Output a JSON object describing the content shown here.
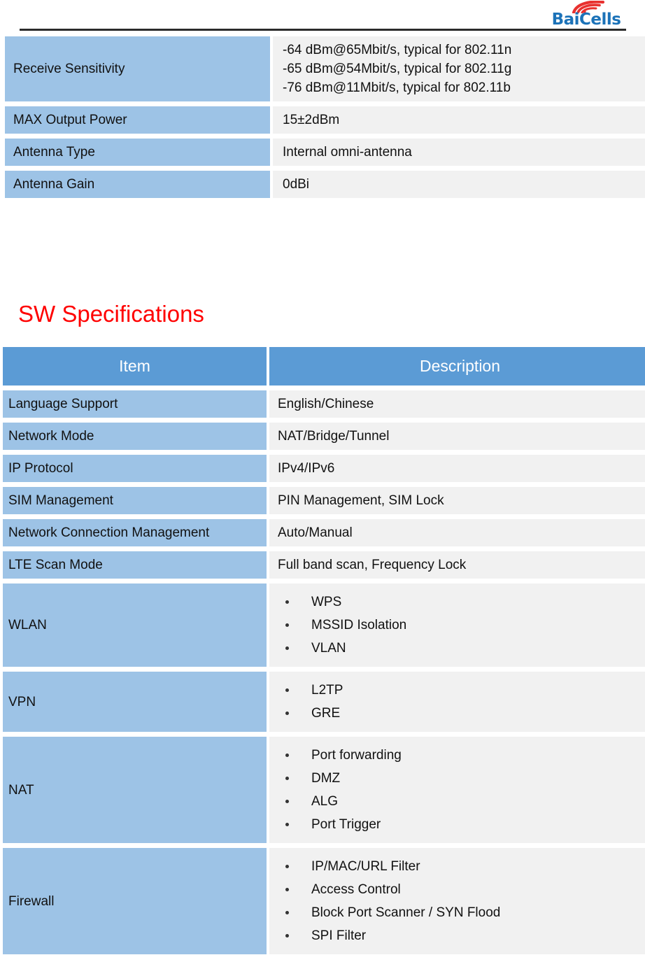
{
  "header": {
    "brand_name": "BaiCells",
    "logo_icon": "wifi-signal-icon",
    "brand_color": "#1B72B8",
    "logo_accent_color": "#E8312F"
  },
  "hw_table": {
    "rows": [
      {
        "item": "Receive Sensitivity",
        "description": "-64 dBm@65Mbit/s, typical for 802.11n\n-65 dBm@54Mbit/s, typical for 802.11g\n-76 dBm@11Mbit/s, typical for 802.11b"
      },
      {
        "item": "MAX Output Power",
        "description": "15±2dBm"
      },
      {
        "item": "Antenna Type",
        "description": "Internal omni-antenna"
      },
      {
        "item": "Antenna Gain",
        "description": "0dBi"
      }
    ]
  },
  "sw_section": {
    "title": "SW Specifications",
    "title_color": "#FF0000",
    "header": {
      "item": "Item",
      "description": "Description"
    },
    "rows": [
      {
        "item": "Language Support",
        "description": "English/Chinese"
      },
      {
        "item": "Network Mode",
        "description": "NAT/Bridge/Tunnel"
      },
      {
        "item": "IP Protocol",
        "description": "IPv4/IPv6"
      },
      {
        "item": "SIM Management",
        "description": "PIN Management, SIM Lock"
      },
      {
        "item": "Network Connection Management",
        "description": "Auto/Manual"
      },
      {
        "item": "LTE Scan Mode",
        "description": "Full band scan, Frequency Lock"
      },
      {
        "item": "WLAN",
        "bullets": [
          "WPS",
          "MSSID Isolation",
          "VLAN"
        ]
      },
      {
        "item": "VPN",
        "bullets": [
          "L2TP",
          "GRE"
        ]
      },
      {
        "item": "NAT",
        "bullets": [
          "Port forwarding",
          "DMZ",
          "ALG",
          "Port Trigger"
        ]
      },
      {
        "item": "Firewall",
        "bullets": [
          "IP/MAC/URL Filter",
          "Access Control",
          "Block Port Scanner / SYN Flood",
          "SPI Filter"
        ]
      }
    ]
  },
  "colors": {
    "header_row_blue": "#5B9BD5",
    "key_cell_blue": "#9DC3E6",
    "value_cell_gray": "#F1F1F1",
    "rule_dark": "#2B2B2B"
  }
}
